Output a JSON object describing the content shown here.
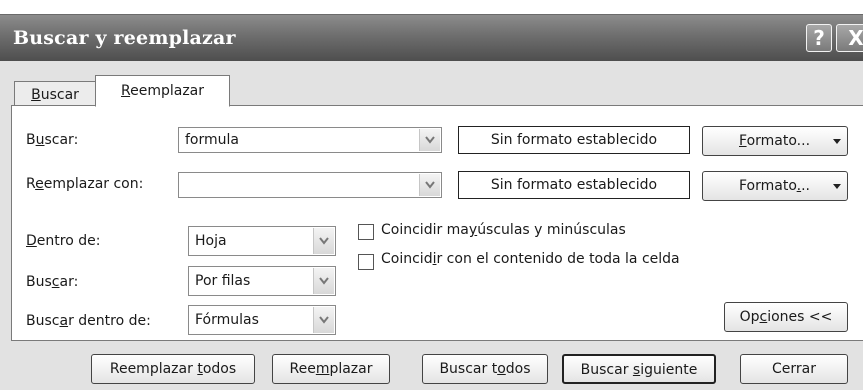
{
  "window": {
    "title": "Buscar y reemplazar",
    "help_label": "?",
    "close_label": "X"
  },
  "tabs": [
    {
      "label_pre": "",
      "label_u": "B",
      "label_post": "uscar"
    },
    {
      "label_pre": "",
      "label_u": "R",
      "label_post": "eemplazar"
    }
  ],
  "find": {
    "label_pre": "B",
    "label_u": "u",
    "label_post": "scar:",
    "value": "formula",
    "format_status": "Sin formato establecido",
    "format_btn_u": "F",
    "format_btn_post": "ormato..."
  },
  "replace": {
    "label_pre": "R",
    "label_u": "e",
    "label_post": "emplazar con:",
    "value": "",
    "format_status": "Sin formato establecido",
    "format_btn_pre": "Formato",
    "format_btn_u": ".",
    "format_btn_post": ".."
  },
  "options": {
    "within": {
      "label_u": "D",
      "label_post": "entro de:",
      "value": "Hoja"
    },
    "search": {
      "label_pre": "Bus",
      "label_u": "c",
      "label_post": "ar:",
      "value": "Por filas"
    },
    "lookin": {
      "label_pre": "Busc",
      "label_u": "a",
      "label_post": "r dentro de:",
      "value": "Fórmulas"
    },
    "match_case": {
      "pre": "Coincidir ma",
      "u": "y",
      "post": "úsculas y minúsculas",
      "checked": false
    },
    "match_cell": {
      "pre": "Coincid",
      "u": "i",
      "post": "r con el contenido de toda la celda",
      "checked": false
    },
    "options_btn": {
      "pre": "Op",
      "u": "c",
      "post": "iones <<"
    }
  },
  "buttons": {
    "replace_all": {
      "pre": "Reemplazar ",
      "u": "t",
      "post": "odos"
    },
    "replace": {
      "pre": "Ree",
      "u": "m",
      "post": "plazar"
    },
    "find_all": {
      "pre": "Buscar t",
      "u": "o",
      "post": "dos"
    },
    "find_next": {
      "pre": "Buscar ",
      "u": "s",
      "post": "iguiente"
    },
    "close": {
      "pre": "Cerrar",
      "u": "",
      "post": ""
    }
  }
}
